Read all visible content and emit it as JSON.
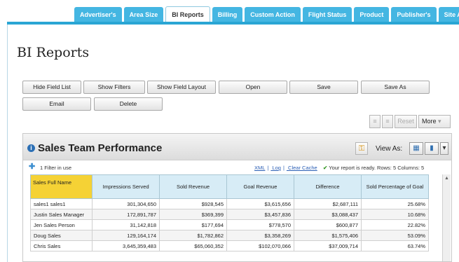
{
  "tabs": [
    {
      "label": "Advertiser's",
      "active": false
    },
    {
      "label": "Area Size",
      "active": false
    },
    {
      "label": "BI Reports",
      "active": true
    },
    {
      "label": "Billing",
      "active": false
    },
    {
      "label": "Custom Action",
      "active": false
    },
    {
      "label": "Flight Status",
      "active": false
    },
    {
      "label": "Product",
      "active": false
    },
    {
      "label": "Publisher's",
      "active": false
    },
    {
      "label": "Site A",
      "active": false
    }
  ],
  "page": {
    "title": "BI Reports"
  },
  "toolbar": {
    "hide_field_list": "Hide Field List",
    "show_filters": "Show Filters",
    "show_field_layout": "Show Field Layout",
    "open": "Open",
    "save": "Save",
    "save_as": "Save As",
    "email": "Email",
    "delete": "Delete"
  },
  "mini_toolbar": {
    "reset": "Reset",
    "more": "More"
  },
  "report": {
    "title": "Sales Team Performance",
    "view_as": "View As:",
    "filter_text": "1 Filter in use",
    "links": {
      "xml": "XML",
      "log": "Log",
      "clear_cache": "Clear Cache"
    },
    "link_sep": "|",
    "status": "Your report is ready.",
    "rows_label": "Rows: 5",
    "columns_label": "Columns: 5",
    "columns": [
      "Sales Full Name",
      "Impressions Served",
      "Sold Revenue",
      "Goal Revenue",
      "Difference",
      "Sold Percentage of Goal"
    ],
    "rows": [
      [
        "sales1 sales1",
        "301,304,650",
        "$928,545",
        "$3,615,656",
        "$2,687,111",
        "25.68%"
      ],
      [
        "Justin Sales Manager",
        "172,891,787",
        "$369,399",
        "$3,457,836",
        "$3,088,437",
        "10.68%"
      ],
      [
        "Jen Sales Person",
        "31,142,818",
        "$177,694",
        "$778,570",
        "$600,877",
        "22.82%"
      ],
      [
        "Doug Sales",
        "129,164,174",
        "$1,782,862",
        "$3,358,269",
        "$1,575,406",
        "53.09%"
      ],
      [
        "Chris Sales",
        "3,645,359,483",
        "$65,060,352",
        "$102,070,066",
        "$37,009,714",
        "63.74%"
      ]
    ]
  },
  "colors": {
    "tab_blue": "#44b6e2",
    "accent_line": "#2aa6d4",
    "header_highlight": "#f5d235",
    "header_cell": "#d7ecf6",
    "link": "#2b5fb5"
  }
}
